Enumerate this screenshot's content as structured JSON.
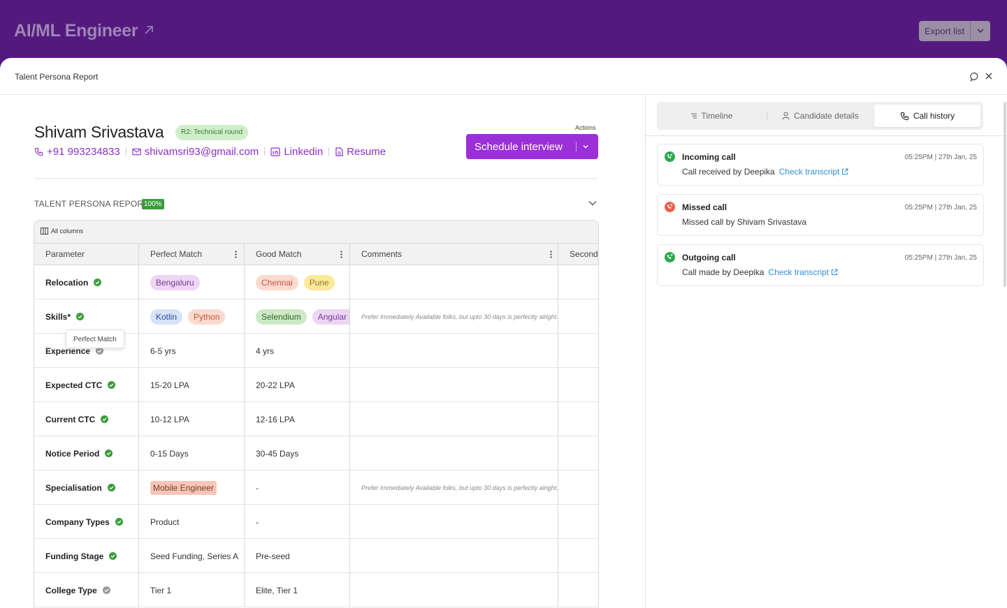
{
  "header": {
    "title": "AI/ML Engineer",
    "export_label": "Export list"
  },
  "sheet": {
    "title": "Talent Persona Report"
  },
  "candidate": {
    "name": "Shivam Srivastava",
    "round": "R2: Technical round",
    "phone": "+91 993234833",
    "email": "shivamsri93@gmail.com",
    "linkedin": "Linkedin",
    "resume": "Resume",
    "actions_label": "Actions",
    "schedule_label": "Schedule interview"
  },
  "report": {
    "title": "TALENT PERSONA REPORT",
    "completion": "100%",
    "all_columns": "All columns",
    "columns": [
      "Parameter",
      "Perfect Match",
      "Good Match",
      "Comments",
      "Second"
    ],
    "tooltip": "Perfect Match",
    "rows": [
      {
        "param": "Relocation",
        "status": "matched",
        "perfect_chips": [
          "Bengaluru"
        ],
        "good_chips": [
          "Chennai",
          "Pune"
        ],
        "comment": ""
      },
      {
        "param": "Skills*",
        "status": "matched",
        "perfect_chips": [
          "Kotlin",
          "Python"
        ],
        "good_chips": [
          "Selendium",
          "Angular J"
        ],
        "comment": "Prefer Immediately Available folks, but upto 30 days is perfectly alright."
      },
      {
        "param": "Experience",
        "status": "neutral",
        "perfect": "6-5 yrs",
        "good": "4 yrs",
        "comment": ""
      },
      {
        "param": "Expected CTC",
        "status": "matched",
        "perfect": "15-20 LPA",
        "good": "20-22 LPA",
        "comment": ""
      },
      {
        "param": "Current CTC",
        "status": "matched",
        "perfect": "10-12 LPA",
        "good": "12-16 LPA",
        "comment": ""
      },
      {
        "param": "Notice Period",
        "status": "matched",
        "perfect": "0-15 Days",
        "good": "30-45 Days",
        "comment": ""
      },
      {
        "param": "Specialisation",
        "status": "matched",
        "perfect_tag": "Mobile Engineer",
        "good": "-",
        "comment": "Prefer Immediately Available folks, but upto 30 days is perfectly alright."
      },
      {
        "param": "Company Types",
        "status": "matched",
        "perfect": "Product",
        "good": "-",
        "comment": ""
      },
      {
        "param": "Funding Stage",
        "status": "matched",
        "perfect": "Seed Funding, Series A",
        "good": "Pre-seed",
        "comment": ""
      },
      {
        "param": "College Type",
        "status": "neutral",
        "perfect": "Tier 1",
        "good": "Elite, Tier 1",
        "comment": ""
      }
    ]
  },
  "right": {
    "tabs": [
      {
        "label": "Timeline",
        "icon": "timeline-icon"
      },
      {
        "label": "Candidate details",
        "icon": "user-icon"
      },
      {
        "label": "Call history",
        "icon": "phone-icon",
        "active": true
      }
    ],
    "calls": [
      {
        "type": "incoming",
        "title": "Incoming call",
        "time": "05:25PM | 27th Jan, 25",
        "desc": "Call received by Deepika",
        "link": "Check transcript"
      },
      {
        "type": "missed",
        "title": "Missed call",
        "time": "05:25PM | 27th Jan, 25",
        "desc": "Missed call by Shivam Srivastava",
        "link": ""
      },
      {
        "type": "outgoing",
        "title": "Outgoing call",
        "time": "05:25PM | 27th Jan, 25",
        "desc": "Call made by Deepika",
        "link": "Check transcript"
      }
    ]
  },
  "colors": {
    "brand": "#54197e",
    "accent": "#9b30d9",
    "success": "#3a9d3a",
    "missed": "#e8604a",
    "link": "#2d8fd6"
  }
}
